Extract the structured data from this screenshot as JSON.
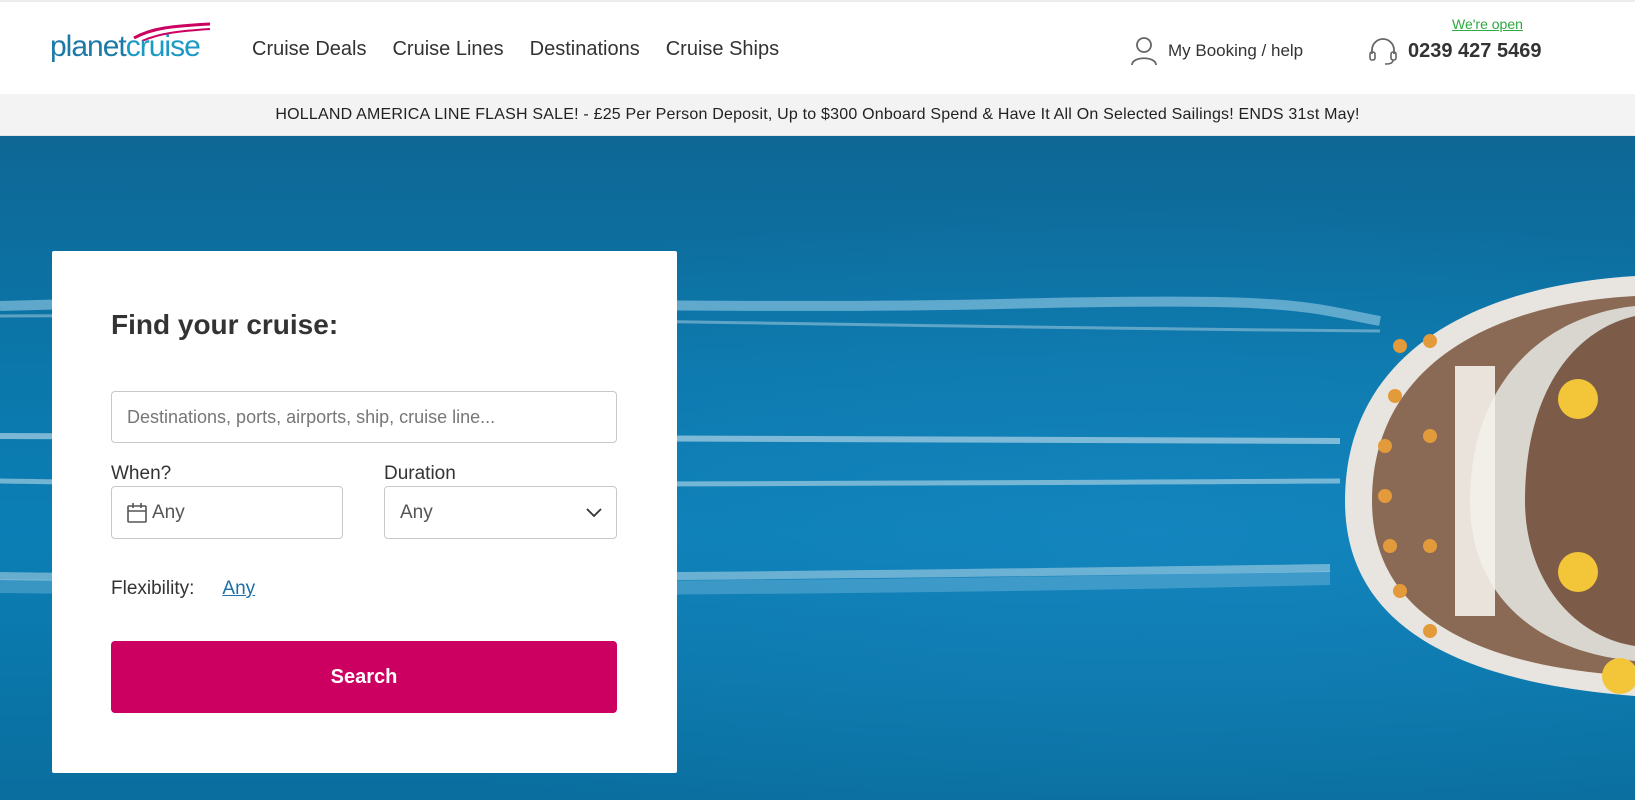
{
  "logo": {
    "part1": "planet",
    "part2": "cruise"
  },
  "nav": [
    {
      "label": "Cruise Deals"
    },
    {
      "label": "Cruise Lines"
    },
    {
      "label": "Destinations"
    },
    {
      "label": "Cruise Ships"
    }
  ],
  "account": {
    "label": "My Booking / help",
    "icon": "user-icon"
  },
  "contact": {
    "status": "We're open",
    "phone": "0239 427 5469",
    "icon": "headset-icon",
    "status_color": "#2ca940"
  },
  "promo": {
    "text": "HOLLAND AMERICA LINE FLASH SALE! - £25 Per Person Deposit, Up to $300 Onboard Spend & Have It All On Selected Sailings! ENDS 31st May!"
  },
  "search": {
    "title": "Find your cruise:",
    "placeholder": "Destinations, ports, airports, ship, cruise line...",
    "when_label": "When?",
    "when_value": "Any",
    "duration_label": "Duration",
    "duration_value": "Any",
    "flexibility_label": "Flexibility:",
    "flexibility_value": "Any",
    "button_label": "Search",
    "button_color": "#cc0060"
  }
}
